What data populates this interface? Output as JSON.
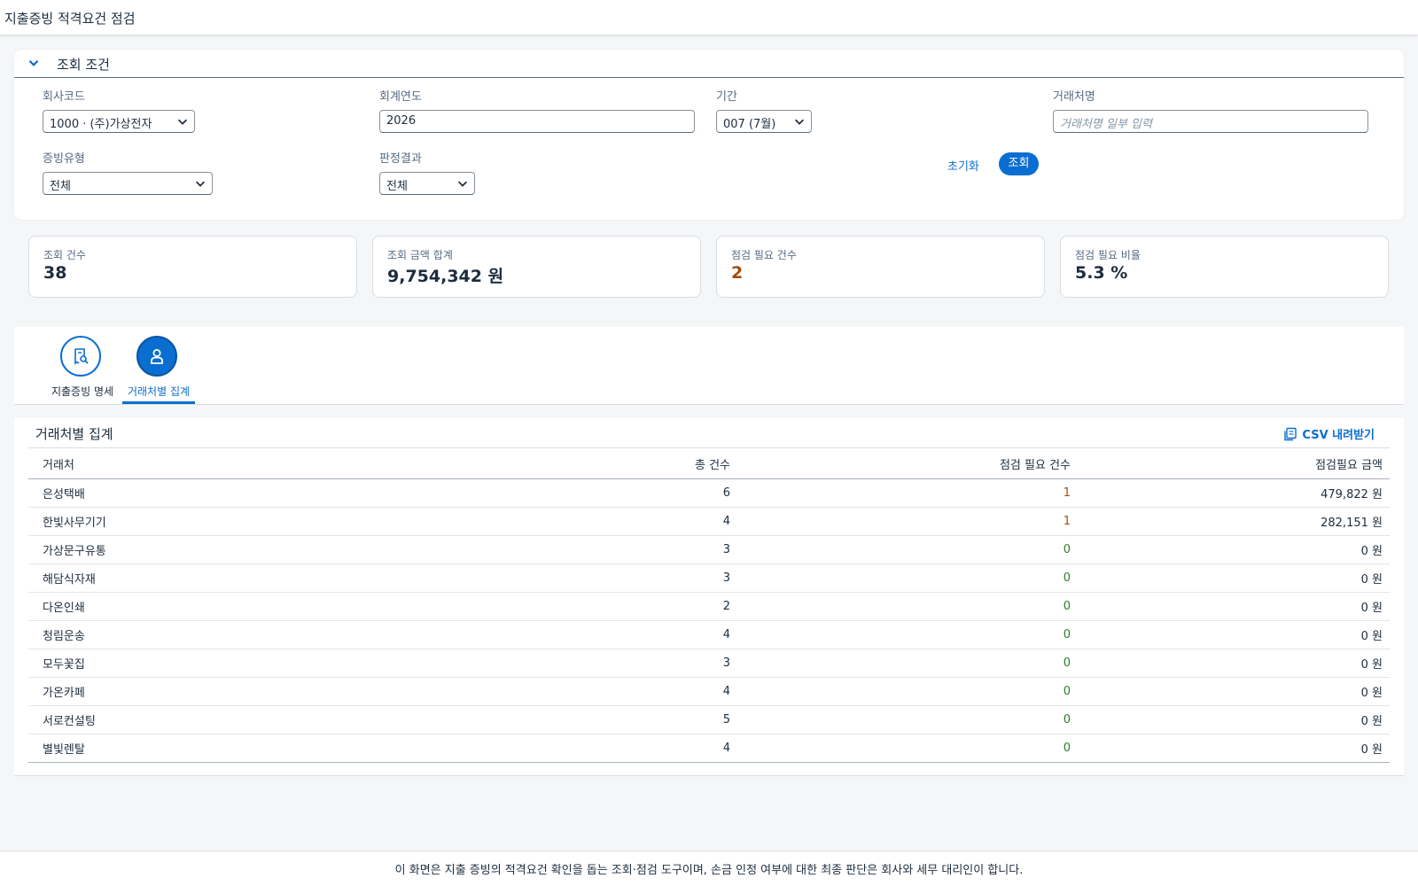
{
  "app": {
    "title": "지출증빙 적격요건 점검"
  },
  "filter": {
    "header": "조회 조건",
    "company_label": "회사코드",
    "company_value": "1000 · (주)가상전자",
    "year_label": "회계연도",
    "year_value": "2026",
    "period_label": "기간",
    "period_value": "007 (7월)",
    "vendor_label": "거래처명",
    "vendor_placeholder": "거래처명 일부 입력",
    "doc_type_label": "증빙유형",
    "doc_type_value": "전체",
    "result_label": "판정결과",
    "result_value": "전체",
    "reset_label": "초기화",
    "search_label": "조회"
  },
  "kpis": [
    {
      "label": "조회 건수",
      "value": "38"
    },
    {
      "label": "조회 금액 합계",
      "value": "9,754,342 원"
    },
    {
      "label": "점검 필요 건수",
      "value": "2"
    },
    {
      "label": "점검 필요 비율",
      "value": "5.3 %"
    }
  ],
  "tabs": [
    {
      "label": "지출증빙 명세",
      "icon": "receipt-search-icon",
      "active": false
    },
    {
      "label": "거래처별 집계",
      "icon": "person-icon",
      "active": true
    }
  ],
  "table": {
    "title": "거래처별 집계",
    "csv_label": "CSV 내려받기",
    "columns": [
      "거래처",
      "총 건수",
      "점검 필요 건수",
      "점검필요 금액"
    ],
    "rows": [
      {
        "vendor": "은성택배",
        "total": "6",
        "flagged": "1",
        "amount": "479,822 원"
      },
      {
        "vendor": "한빛사무기기",
        "total": "4",
        "flagged": "1",
        "amount": "282,151 원"
      },
      {
        "vendor": "가상문구유통",
        "total": "3",
        "flagged": "0",
        "amount": "0 원"
      },
      {
        "vendor": "해담식자재",
        "total": "3",
        "flagged": "0",
        "amount": "0 원"
      },
      {
        "vendor": "다온인쇄",
        "total": "2",
        "flagged": "0",
        "amount": "0 원"
      },
      {
        "vendor": "청림운송",
        "total": "4",
        "flagged": "0",
        "amount": "0 원"
      },
      {
        "vendor": "모두꽃집",
        "total": "3",
        "flagged": "0",
        "amount": "0 원"
      },
      {
        "vendor": "가온카페",
        "total": "4",
        "flagged": "0",
        "amount": "0 원"
      },
      {
        "vendor": "서로컨설팅",
        "total": "5",
        "flagged": "0",
        "amount": "0 원"
      },
      {
        "vendor": "별빛렌탈",
        "total": "4",
        "flagged": "0",
        "amount": "0 원"
      }
    ]
  },
  "footer": {
    "text": "이 화면은 지출 증빙의 적격요건 확인을 돕는 조회·점검 도구이며, 손금 인정 여부에 대한 최종 판단은 회사와 세무 대리인이 합니다."
  },
  "colors": {
    "accent": "#0a6ed1",
    "warning": "#a14e0c",
    "ok": "#2b7d2b"
  }
}
